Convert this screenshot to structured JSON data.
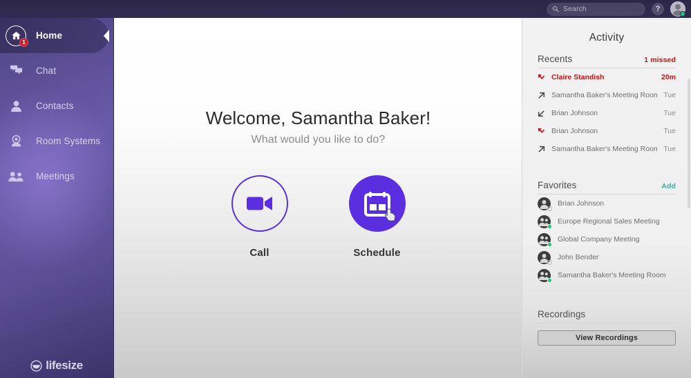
{
  "topbar": {
    "search": {
      "placeholder": "Search",
      "icon": "search-icon"
    },
    "help_label": "?",
    "avatar": {
      "icon": "user-avatar",
      "presence": "online"
    }
  },
  "sidebar": {
    "items": [
      {
        "label": "Home",
        "icon": "home-icon",
        "active": true,
        "badge": "1"
      },
      {
        "label": "Chat",
        "icon": "chat-icon",
        "active": false,
        "badge": ""
      },
      {
        "label": "Contacts",
        "icon": "contact-icon",
        "active": false,
        "badge": ""
      },
      {
        "label": "Room Systems",
        "icon": "room-system-icon",
        "active": false,
        "badge": ""
      },
      {
        "label": "Meetings",
        "icon": "meetings-icon",
        "active": false,
        "badge": ""
      }
    ],
    "logo": {
      "word": "lifesize",
      "icon": "lifesize-logo-icon",
      "tm": "®"
    }
  },
  "main": {
    "welcome": "Welcome, Samantha Baker!",
    "subtitle": "What would you like to do?",
    "actions": [
      {
        "label": "Call",
        "icon": "video-camera-icon",
        "style": "outline"
      },
      {
        "label": "Schedule",
        "icon": "calendar-icon",
        "style": "filled"
      }
    ]
  },
  "activity": {
    "title": "Activity",
    "recents": {
      "heading": "Recents",
      "missed_label": "1 missed",
      "rows": [
        {
          "name": "Claire Standish",
          "time": "20m",
          "type": "missed",
          "icon": "missed-call-icon"
        },
        {
          "name": "Samantha Baker's Meeting Room",
          "time": "Tue",
          "type": "outgoing",
          "icon": "outgoing-call-icon"
        },
        {
          "name": "Brian Johnson",
          "time": "Tue",
          "type": "incoming",
          "icon": "incoming-call-icon"
        },
        {
          "name": "Brian Johnson",
          "time": "Tue",
          "type": "missed",
          "icon": "missed-call-icon"
        },
        {
          "name": "Samantha Baker's Meeting Room",
          "time": "Tue",
          "type": "outgoing",
          "icon": "outgoing-call-icon"
        }
      ]
    },
    "favorites": {
      "heading": "Favorites",
      "add_label": "Add",
      "rows": [
        {
          "name": "Brian Johnson",
          "kind": "person",
          "presence": "offline"
        },
        {
          "name": "Europe Regional Sales Meeting",
          "kind": "group",
          "presence": "online"
        },
        {
          "name": "Global Company Meeting",
          "kind": "group",
          "presence": "online"
        },
        {
          "name": "John Bender",
          "kind": "person",
          "presence": "offline"
        },
        {
          "name": "Samantha Baker's Meeting Room",
          "kind": "group",
          "presence": "online"
        }
      ]
    },
    "recordings": {
      "heading": "Recordings",
      "button_label": "View Recordings"
    }
  },
  "colors": {
    "brand_purple": "#5b2fe0",
    "sidebar_purple": "#6b5bab",
    "header_dark": "#2c2748",
    "missed_red": "#cc1111",
    "link_teal": "#45a6a4",
    "online_green": "#22c07a"
  }
}
